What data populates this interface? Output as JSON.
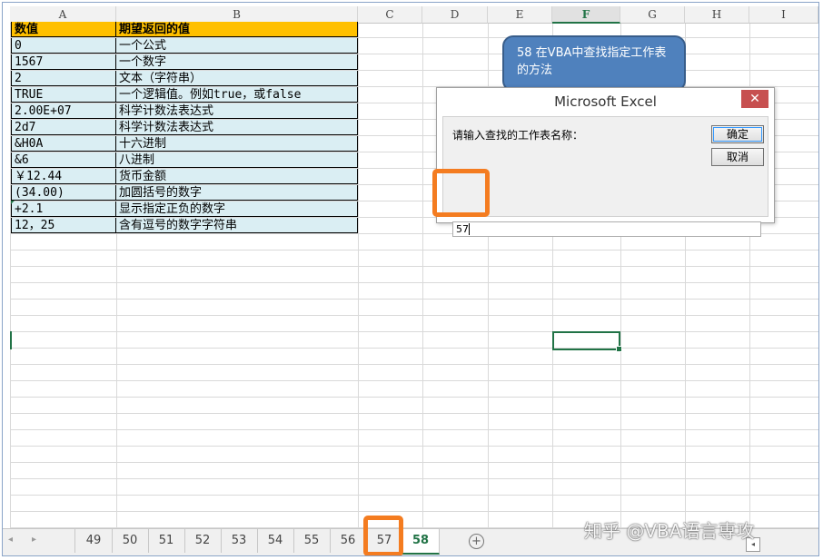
{
  "columns": [
    "A",
    "B",
    "C",
    "D",
    "E",
    "F",
    "G",
    "H",
    "I"
  ],
  "selected_column": "F",
  "table": {
    "header": [
      "数值",
      "期望返回的值"
    ],
    "rows": [
      [
        "0",
        "一个公式"
      ],
      [
        "1567",
        "一个数字"
      ],
      [
        "2",
        "文本（字符串）"
      ],
      [
        "TRUE",
        "一个逻辑值。例如true，或false"
      ],
      [
        "2.00E+07",
        "科学计数法表达式"
      ],
      [
        "2d7",
        "科学计数法表达式"
      ],
      [
        "&H0A",
        "十六进制"
      ],
      [
        "&6",
        "八进制"
      ],
      [
        "￥12.44",
        "货币金额"
      ],
      [
        "(34.00)",
        "加圆括号的数字"
      ],
      [
        "+2.1",
        "显示指定正负的数字"
      ],
      [
        "12，25",
        "含有逗号的数字字符串"
      ]
    ]
  },
  "callout": {
    "text": "58 在VBA中查找指定工作表的方法"
  },
  "dialog": {
    "title": "Microsoft Excel",
    "close_label": "✕",
    "prompt": "请输入查找的工作表名称：",
    "ok_label": "确定",
    "cancel_label": "取消",
    "input_value": "57"
  },
  "sheet_tabs": [
    "49",
    "50",
    "51",
    "52",
    "53",
    "54",
    "55",
    "56",
    "57",
    "58"
  ],
  "active_tab": "58",
  "nav": {
    "prev": "◂",
    "next": "▸",
    "add": "+"
  },
  "watermark": "知乎 @VBA语言専攻",
  "colors": {
    "header_fill": "#ffc000",
    "row_fill": "#daeef3",
    "callout": "#4f81bd",
    "highlight": "#f47c20",
    "excel_green": "#217346"
  }
}
